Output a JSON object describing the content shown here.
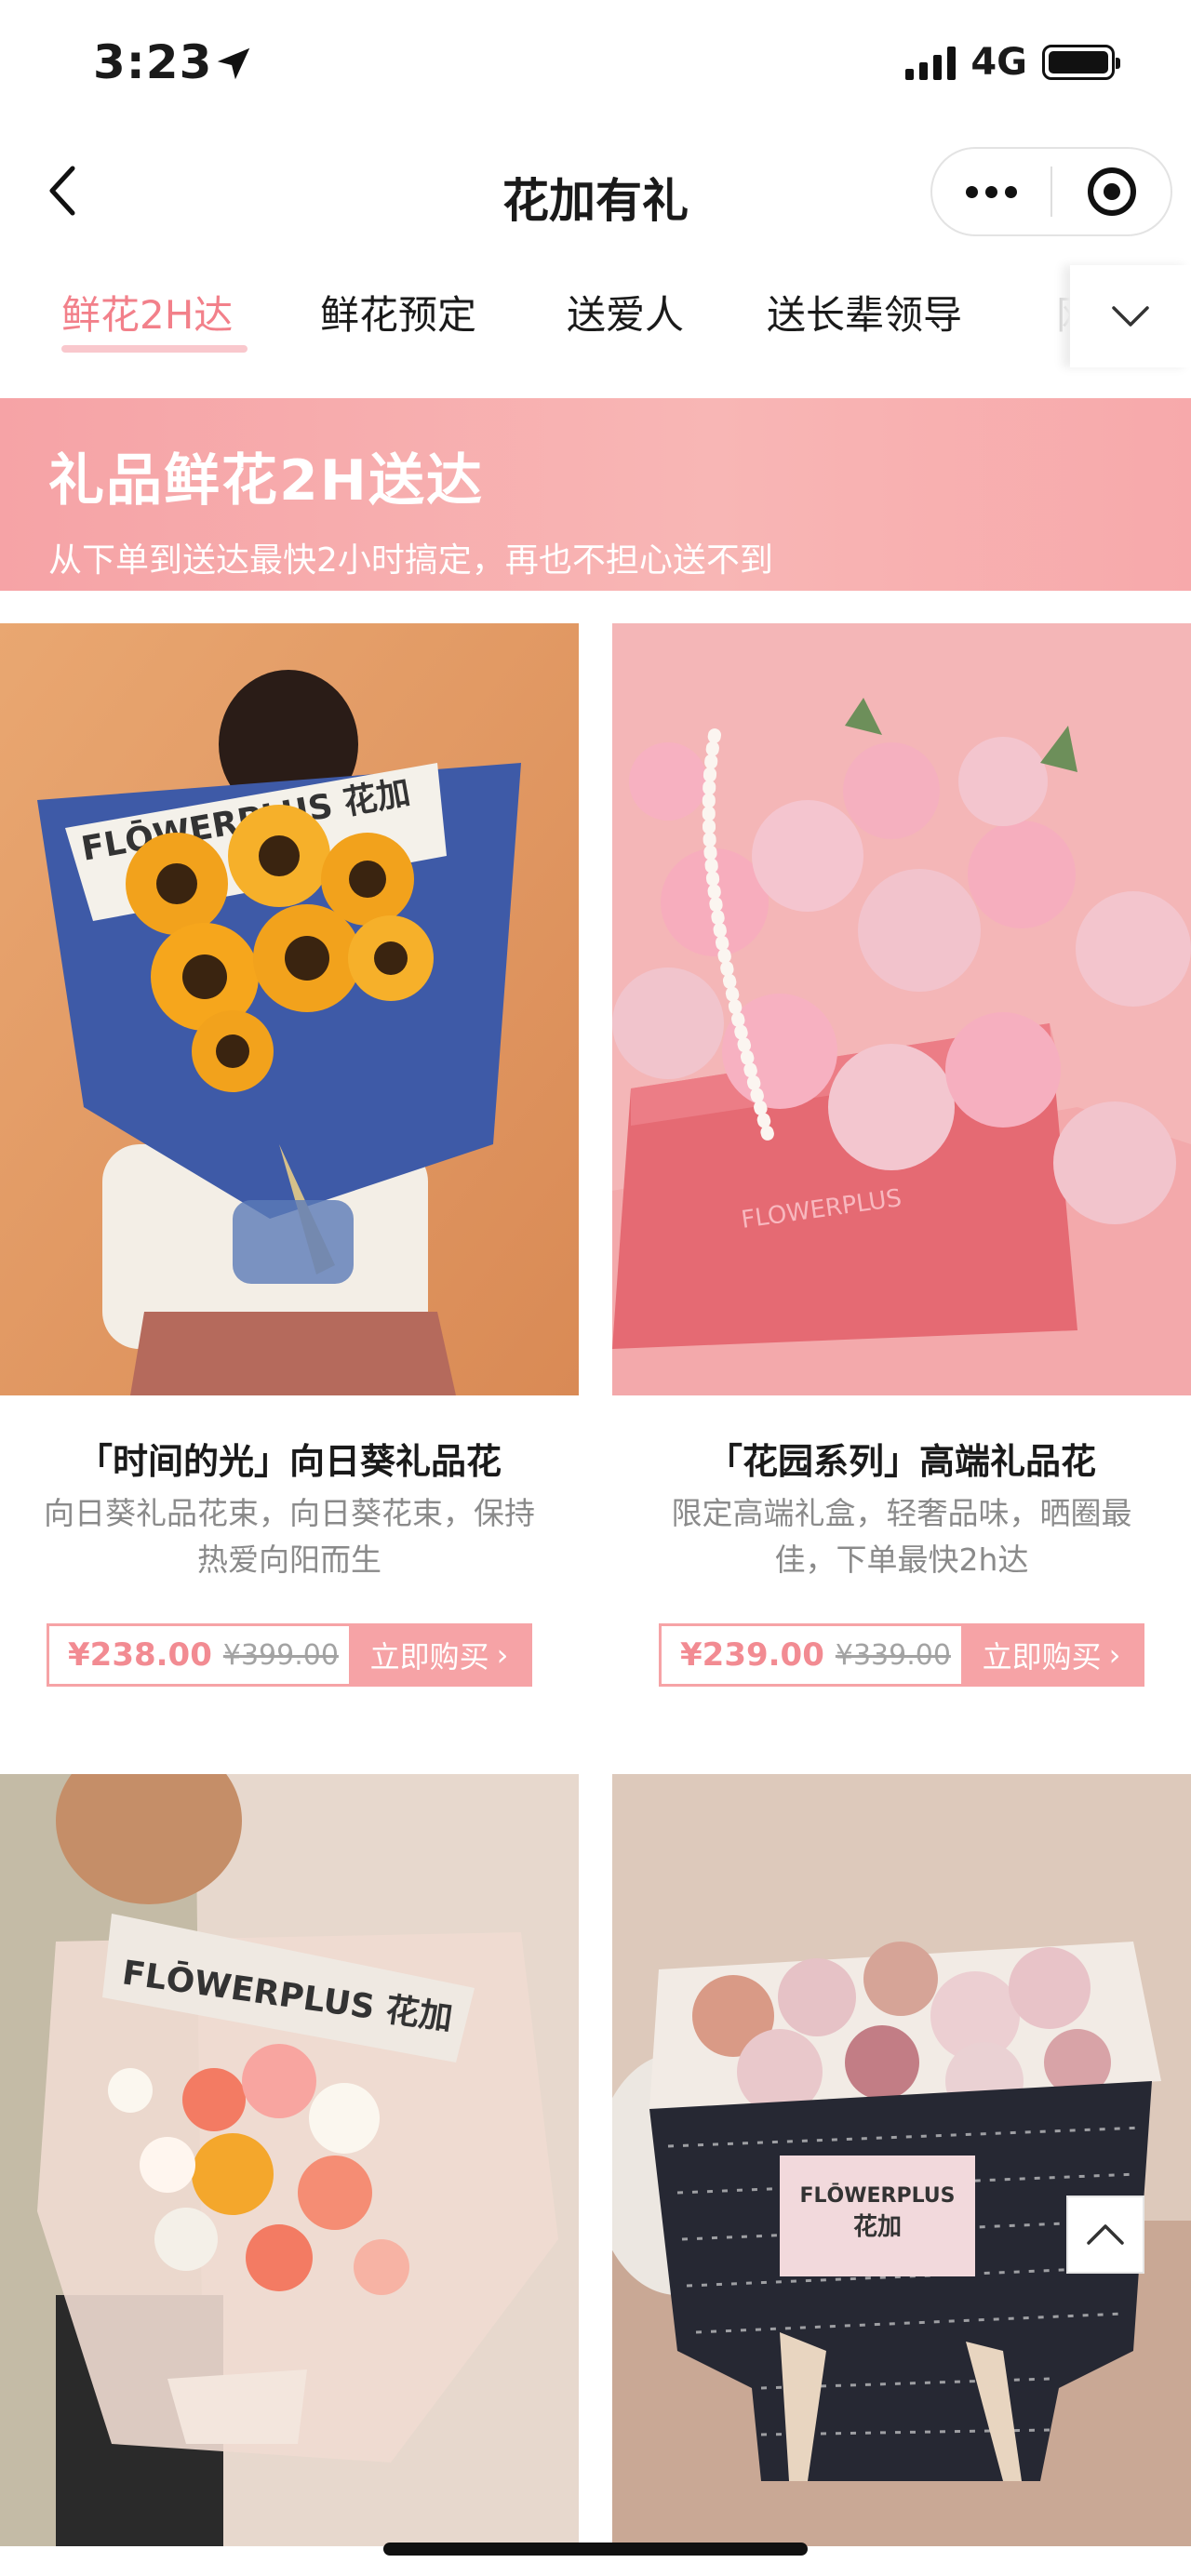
{
  "status_bar": {
    "time": "3:23",
    "network": "4G",
    "icons": [
      "location-arrow-icon",
      "signal-icon",
      "battery-icon"
    ]
  },
  "nav": {
    "title": "花加有礼",
    "icons": [
      "back-icon",
      "more-icon",
      "close-mini-program-icon"
    ]
  },
  "tabs": [
    {
      "label": "鲜花2H达",
      "active": true
    },
    {
      "label": "鲜花预定",
      "active": false
    },
    {
      "label": "送爱人",
      "active": false
    },
    {
      "label": "送长辈领导",
      "active": false
    },
    {
      "label": "网",
      "active": false
    }
  ],
  "banner": {
    "title": "礼品鲜花2H送达",
    "subtitle": "从下单到送达最快2小时搞定，再也不担心送不到"
  },
  "products": [
    {
      "title": "「时间的光」向日葵礼品花",
      "desc": "向日葵礼品花束，向日葵花束，保持热爱向阳而生",
      "price": "¥238.00",
      "original_price": "¥399.00",
      "buy_label": "立即购买",
      "image": {
        "brand": "FLŌWERPLUS 花加"
      }
    },
    {
      "title": "「花园系列」高端礼品花",
      "desc": "限定高端礼盒，轻奢品味，晒圈最佳，下单最快2h达",
      "price": "¥239.00",
      "original_price": "¥339.00",
      "buy_label": "立即购买",
      "image": {
        "brand": "FLOWERPLUS"
      }
    },
    {
      "title": "",
      "desc": "",
      "price": "",
      "original_price": "",
      "buy_label": "",
      "image": {
        "brand": "FLŌWERPLUS 花加"
      }
    },
    {
      "title": "",
      "desc": "",
      "price": "",
      "original_price": "",
      "buy_label": "",
      "image": {
        "brand_line1": "FLŌWERPLUS",
        "brand_line2": "花加"
      }
    }
  ],
  "colors": {
    "accent": "#f28b92",
    "banner": "#f6a3a6",
    "button": "#f6a3a6"
  }
}
